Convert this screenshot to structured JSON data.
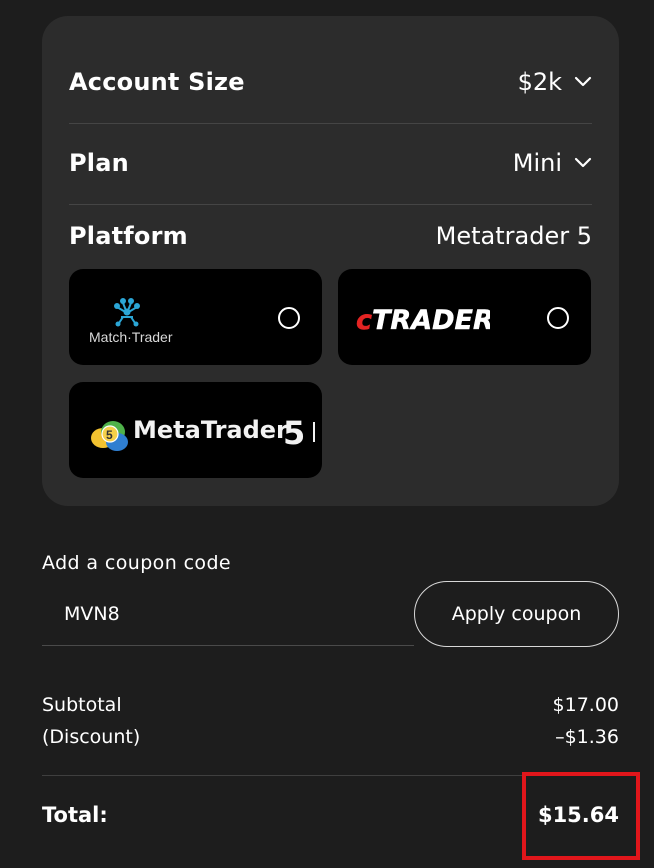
{
  "config": {
    "account_size": {
      "label": "Account Size",
      "value": "$2k"
    },
    "plan": {
      "label": "Plan",
      "value": "Mini"
    },
    "platform": {
      "label": "Platform",
      "selected": "Metatrader 5",
      "options": [
        {
          "name": "Match-Trader",
          "logo_text": "Match·Trader",
          "selected": false
        },
        {
          "name": "cTrader",
          "logo_text": "cTRADER",
          "selected": false
        },
        {
          "name": "MetaTrader 5",
          "logo_text": "MetaTrader",
          "logo_number": "5",
          "selected": true
        }
      ]
    }
  },
  "coupon": {
    "label": "Add a coupon code",
    "value": "MVN8",
    "button_label": "Apply coupon"
  },
  "summary": {
    "subtotal_label": "Subtotal",
    "subtotal_value": "$17.00",
    "discount_label": "(Discount)",
    "discount_value": "–$1.36",
    "total_label": "Total:",
    "total_value": "$15.64"
  },
  "colors": {
    "background": "#1d1d1d",
    "card": "#2c2c2c",
    "tile": "#000000",
    "highlight": "#e0161b",
    "matchtrader_accent": "#2ba6d6",
    "ctrader_red": "#e42423"
  },
  "icons": [
    "chevron-down-icon",
    "radio-icon",
    "matchtrader-logo",
    "ctrader-logo",
    "metatrader5-logo"
  ]
}
